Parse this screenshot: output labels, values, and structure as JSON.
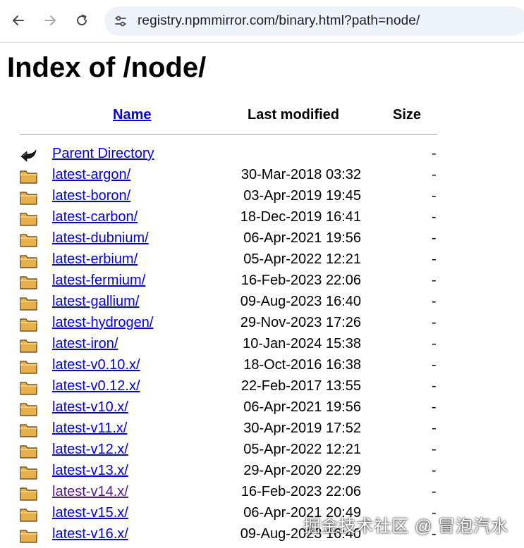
{
  "browser": {
    "url": "registry.npmmirror.com/binary.html?path=node/"
  },
  "page": {
    "title": "Index of /node/",
    "columns": {
      "name": "Name",
      "last_modified": "Last modified",
      "size": "Size"
    },
    "parent": {
      "label": "Parent Directory",
      "size": "-",
      "icon": "back-arrow-icon"
    },
    "entries": [
      {
        "name": "latest-argon/",
        "modified": "30-Mar-2018 03:32",
        "size": "-"
      },
      {
        "name": "latest-boron/",
        "modified": "03-Apr-2019 19:45",
        "size": "-"
      },
      {
        "name": "latest-carbon/",
        "modified": "18-Dec-2019 16:41",
        "size": "-"
      },
      {
        "name": "latest-dubnium/",
        "modified": "06-Apr-2021 19:56",
        "size": "-"
      },
      {
        "name": "latest-erbium/",
        "modified": "05-Apr-2022 12:21",
        "size": "-"
      },
      {
        "name": "latest-fermium/",
        "modified": "16-Feb-2023 22:06",
        "size": "-"
      },
      {
        "name": "latest-gallium/",
        "modified": "09-Aug-2023 16:40",
        "size": "-"
      },
      {
        "name": "latest-hydrogen/",
        "modified": "29-Nov-2023 17:26",
        "size": "-"
      },
      {
        "name": "latest-iron/",
        "modified": "10-Jan-2024 15:38",
        "size": "-"
      },
      {
        "name": "latest-v0.10.x/",
        "modified": "18-Oct-2016 16:38",
        "size": "-"
      },
      {
        "name": "latest-v0.12.x/",
        "modified": "22-Feb-2017 13:55",
        "size": "-"
      },
      {
        "name": "latest-v10.x/",
        "modified": "06-Apr-2021 19:56",
        "size": "-"
      },
      {
        "name": "latest-v11.x/",
        "modified": "30-Apr-2019 17:52",
        "size": "-"
      },
      {
        "name": "latest-v12.x/",
        "modified": "05-Apr-2022 12:21",
        "size": "-"
      },
      {
        "name": "latest-v13.x/",
        "modified": "29-Apr-2020 22:29",
        "size": "-"
      },
      {
        "name": "latest-v14.x/",
        "modified": "16-Feb-2023 22:06",
        "size": "-",
        "visited": true
      },
      {
        "name": "latest-v15.x/",
        "modified": "06-Apr-2021 20:49",
        "size": "-"
      },
      {
        "name": "latest-v16.x/",
        "modified": "09-Aug-2023 16:40",
        "size": "-"
      }
    ]
  },
  "watermark": "掘金技术社区 @ 冒泡汽水",
  "colors": {
    "link": "#0000ee",
    "visited_link": "#551a8b",
    "folder_fill": "#e8b04a",
    "omnibox_bg": "#eef2f9"
  }
}
